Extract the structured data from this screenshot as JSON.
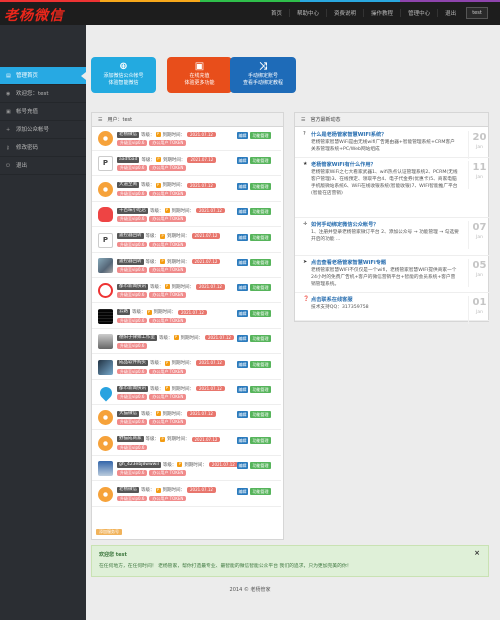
{
  "app": {
    "logo": "老杨微信"
  },
  "nav": {
    "links": [
      "首页",
      "帮助中心",
      "资费说明",
      "操作教程",
      "管理中心",
      "退出"
    ],
    "user": "test"
  },
  "sidebar": {
    "items": [
      {
        "icon": "home-icon",
        "label": "管理首页",
        "active": true
      },
      {
        "icon": "user-icon",
        "label": "欢迎您：test"
      },
      {
        "icon": "wallet-icon",
        "label": "帐号充值"
      },
      {
        "icon": "plus-icon",
        "label": "添加公众帐号"
      },
      {
        "icon": "key-icon",
        "label": "修改密码"
      },
      {
        "icon": "logout-icon",
        "label": "退出"
      }
    ]
  },
  "tiles": [
    {
      "icon": "plus-circle-icon",
      "line1": "添加微信公众帐号",
      "line2": "体验智能微信",
      "color": "#23aae0"
    },
    {
      "icon": "money-icon",
      "line1": "在线充值",
      "line2": "体验更多功能",
      "color": "#e84e1b"
    },
    {
      "icon": "shuffle-icon",
      "line1": "手动绑定账号",
      "line2": "查看手动绑定教程",
      "color": "#1e6bb8"
    }
  ],
  "accounts": {
    "header": "用户：test",
    "level_label": "等级：",
    "expire_label": "到期时间：",
    "edit_label": "编辑",
    "manage_label": "功能管理",
    "rows": [
      {
        "avatar": "orange",
        "name": "老杨微信",
        "date": "2021.07.12",
        "tags": [
          "升级至vip0.6",
          "办公用户 TOKEN"
        ]
      },
      {
        "avatar": "doc",
        "name": "aadfbad",
        "date": "2021.07.12",
        "tags": [
          "升级至vip0.6",
          "办公用户 TOKEN"
        ]
      },
      {
        "avatar": "orange",
        "name": "大道至简",
        "date": "2021.07.12",
        "tags": [
          "升级至vip0.6",
          "办公用户 TOKEN"
        ]
      },
      {
        "avatar": "red",
        "name": "千百味小吃店",
        "date": "2021.07.12",
        "tags": [
          "升级至vip0.6",
          "办公用户 TOKEN"
        ]
      },
      {
        "avatar": "doc",
        "name": "遥控器回转",
        "date": "2021.07.12",
        "tags": [
          "升级至vip0.6",
          "办公用户 TOKEN"
        ]
      },
      {
        "avatar": "photo",
        "name": "遥控器回转",
        "date": "2021.07.12",
        "tags": [
          "升级至vip0.6",
          "办公用户 TOKEN"
        ]
      },
      {
        "avatar": "clock",
        "name": "都市新闻快讯",
        "date": "2021.07.12",
        "tags": [
          "升级至vip0.6",
          "办公用户 TOKEN"
        ]
      },
      {
        "avatar": "qr",
        "name": "云路",
        "date": "2021.07.12",
        "tags": [
          "升级至vip0.6",
          "办公用户 TOKEN"
        ]
      },
      {
        "avatar": "car",
        "name": "德阳子律师工作室",
        "date": "2021.07.12",
        "tags": [
          "升级至vip0.6"
        ]
      },
      {
        "avatar": "dark",
        "name": "成品软件购买",
        "date": "2021.07.12",
        "tags": [
          "升级至vip0.6",
          "办公用户 TOKEN"
        ]
      },
      {
        "avatar": "drop",
        "name": "都市新闻快讯",
        "date": "2021.07.12",
        "tags": [
          "升级至vip0.6",
          "办公用户 TOKEN"
        ]
      },
      {
        "avatar": "orange",
        "name": "大猫微信",
        "date": "2021.07.12",
        "tags": [
          "升级至vip0.6",
          "办公用户 TOKEN"
        ]
      },
      {
        "avatar": "orange",
        "name": "野猫成商家",
        "date": "2021.07.12",
        "tags": [
          "升级至vip0.6"
        ]
      },
      {
        "avatar": "wave",
        "name": "gh_423ebj8wwwiI",
        "date": "2021.07.12",
        "tags": [
          "升级至vip0.6",
          "办公用户 TOKEN"
        ]
      },
      {
        "avatar": "orange",
        "name": "老杨微信",
        "date": "2021.07.12",
        "tags": [
          "升级至vip0.6",
          "办公用户 TOKEN"
        ]
      }
    ],
    "add_hint": "添加服务号"
  },
  "news": {
    "header": "官方最新动态",
    "items": [
      {
        "icon": "question-icon",
        "title": "什么是老杨管家智慧WIFI系统？",
        "body": "老杨管家智慧WiFi是由无线wifi广告路由器+智能管理系统+CRM客户关系管理系统+PC/Web网站组成",
        "day": "20",
        "month": "Jan"
      },
      {
        "icon": "star-icon",
        "title": "老杨管家WiFi有什么作用？",
        "body": "老杨管家WiFi之七大看家武器1、wifi热点认证管理系统2、PCRM(无线客户管理)3、在线预定、领取平台4、电子代金券(优惠卡)5、商家电脑手机版微站系统6、WiFi在线收银系统(智能收银)7、WIFI智能推广平台(智能在店营销)",
        "day": "11",
        "month": "Jan"
      },
      {
        "icon": "arrows-icon",
        "title": "如何手动绑定微信公众帐号？",
        "body": "1、注册并登录老杨管家微订平台 2、添加公众号 → 功能管理 → 勾选要开启的功能 ...",
        "day": "07",
        "month": "Jan"
      },
      {
        "icon": "bullhorn-icon",
        "title": "点击查看老杨管家智慧WiFi专题",
        "body": "老杨管家智慧WIFI不仅仅是一个wifi，老杨管家智慧WIFI提供商家一个24小时的免费广告机+客户的微信营销平台+智能的会员系统+客户营销管理系统。",
        "day": "05",
        "month": "Jan"
      },
      {
        "icon": "question-circle-icon",
        "title": "点击联系在线客服",
        "body": "技术支持QQ：317359758",
        "day": "01",
        "month": "Jan"
      }
    ]
  },
  "welcome": {
    "title": "欢迎您 test",
    "body": "在任何地方，在任何时间！ 老杨管家，帮你打造最专业、最智能的微信智能公众平台 我们的追求，只为更加完美的你！"
  },
  "footer": "2014 © 老杨管家"
}
